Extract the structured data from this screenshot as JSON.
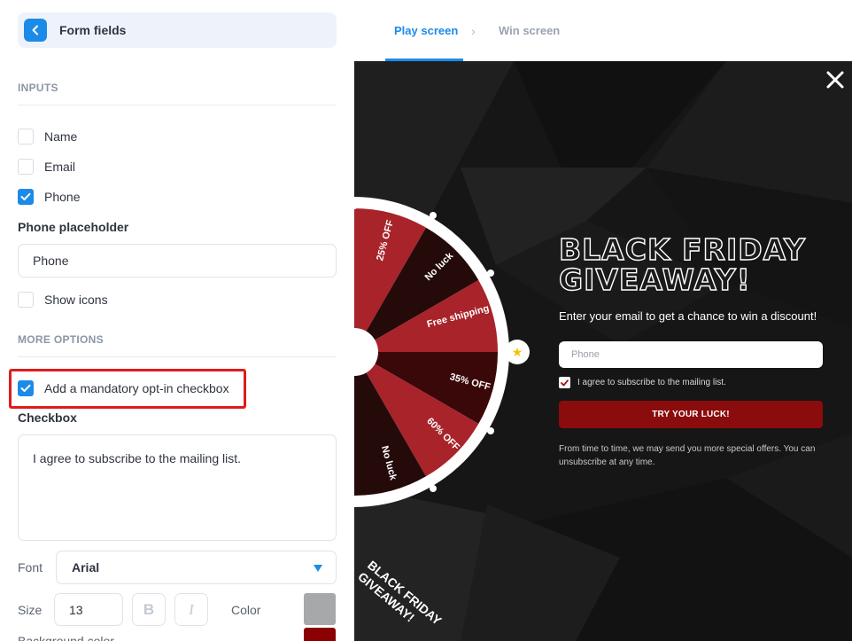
{
  "sidebar": {
    "title": "Form fields",
    "inputs_section": "INPUTS",
    "fields": [
      {
        "label": "Name",
        "checked": false
      },
      {
        "label": "Email",
        "checked": false
      },
      {
        "label": "Phone",
        "checked": true
      }
    ],
    "phone_placeholder_label": "Phone placeholder",
    "phone_placeholder_value": "Phone",
    "show_icons_label": "Show icons",
    "more_section": "MORE OPTIONS",
    "optin_label": "Add a mandatory opt-in checkbox",
    "checkbox_label": "Checkbox",
    "checkbox_text": "I agree to subscribe to the mailing list.",
    "font_label": "Font",
    "font_value": "Arial",
    "size_label": "Size",
    "size_value": "13",
    "bold_glyph": "B",
    "italic_glyph": "I",
    "color_label": "Color",
    "color_swatch": "#a7a8aa",
    "bg_swatch": "#8b0000",
    "cut_label": "Background color"
  },
  "tabs": {
    "play": "Play screen",
    "win": "Win screen"
  },
  "preview": {
    "title_line1": "BLACK FRIDAY",
    "title_line2": "GIVEAWAY!",
    "subtitle": "Enter your email to get a chance to win a discount!",
    "phone_placeholder": "Phone",
    "consent": "I agree to subscribe to the mailing list.",
    "button": "TRY YOUR LUCK!",
    "footer": "From time to time, we may send you more special offers. You can unsubscribe at any time.",
    "corner_line1": "BLACK FRIDAY",
    "corner_line2": "GIVEAWAY!",
    "wheel_segments": [
      "25% OFF",
      "No luck",
      "Free shipping",
      "35% OFF",
      "60% OFF",
      "No luck"
    ],
    "accent": "#8b0c0c"
  }
}
